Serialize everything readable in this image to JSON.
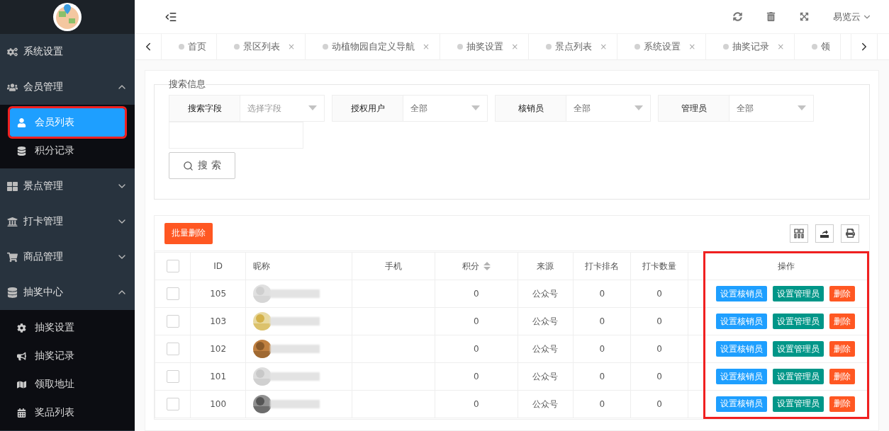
{
  "sidebar": {
    "items": [
      {
        "label": "系统设置"
      },
      {
        "label": "会员管理",
        "expanded": true,
        "children": [
          {
            "label": "会员列表",
            "selected": true,
            "highlighted": true
          },
          {
            "label": "积分记录",
            "selected": false,
            "highlighted": false
          }
        ]
      },
      {
        "label": "景点管理",
        "expanded": false
      },
      {
        "label": "打卡管理",
        "expanded": false
      },
      {
        "label": "商品管理",
        "expanded": false
      },
      {
        "label": "抽奖中心",
        "expanded": true,
        "children": [
          {
            "label": "抽奖设置",
            "selected": false,
            "highlighted": false
          },
          {
            "label": "抽奖记录",
            "selected": false,
            "highlighted": false
          },
          {
            "label": "领取地址",
            "selected": false,
            "highlighted": false
          },
          {
            "label": "奖品列表",
            "selected": false,
            "highlighted": false
          }
        ]
      }
    ]
  },
  "header": {
    "user": "易览云"
  },
  "tabs": [
    {
      "label": "首页"
    },
    {
      "label": "景区列表",
      "close": "×"
    },
    {
      "label": "动植物园自定义导航",
      "close": "×"
    },
    {
      "label": "抽奖设置",
      "close": "×"
    },
    {
      "label": "景点列表",
      "close": "×"
    },
    {
      "label": "系统设置",
      "close": "×"
    },
    {
      "label": "抽奖记录",
      "close": "×"
    },
    {
      "label": "领"
    }
  ],
  "search": {
    "legend": "搜索信息",
    "filters": [
      {
        "label": "搜索字段",
        "placeholder": "选择字段"
      },
      {
        "label": "授权用户",
        "value": "全部"
      },
      {
        "label": "核销员",
        "value": "全部"
      },
      {
        "label": "管理员",
        "value": "全部"
      }
    ],
    "button": "搜 索"
  },
  "table": {
    "batch_delete": "批量删除",
    "select_all_checked": false,
    "columns": [
      {
        "label": "ID",
        "sortable": false
      },
      {
        "label": "昵称",
        "sortable": false
      },
      {
        "label": "手机",
        "sortable": false
      },
      {
        "label": "积分",
        "sortable": true
      },
      {
        "label": "来源",
        "sortable": false
      },
      {
        "label": "打卡排名",
        "sortable": false
      },
      {
        "label": "打卡数量",
        "sortable": false
      },
      {
        "label": "操作",
        "sortable": false,
        "highlighted": true
      }
    ],
    "rows": [
      {
        "checked": false,
        "id": "105",
        "points": "0",
        "source": "公众号",
        "rank": "0",
        "count": "0",
        "actions": [
          "设置核销员",
          "设置管理员",
          "删除"
        ]
      },
      {
        "checked": false,
        "id": "103",
        "points": "0",
        "source": "公众号",
        "rank": "0",
        "count": "0",
        "actions": [
          "设置核销员",
          "设置管理员",
          "删除"
        ]
      },
      {
        "checked": false,
        "id": "102",
        "points": "0",
        "source": "公众号",
        "rank": "0",
        "count": "0",
        "actions": [
          "设置核销员",
          "设置管理员",
          "删除"
        ]
      },
      {
        "checked": false,
        "id": "101",
        "points": "0",
        "source": "公众号",
        "rank": "0",
        "count": "0",
        "actions": [
          "设置核销员",
          "设置管理员",
          "删除"
        ]
      },
      {
        "checked": false,
        "id": "100",
        "points": "0",
        "source": "公众号",
        "rank": "0",
        "count": "0",
        "actions": [
          "设置核销员",
          "设置管理员",
          "删除"
        ]
      }
    ]
  }
}
